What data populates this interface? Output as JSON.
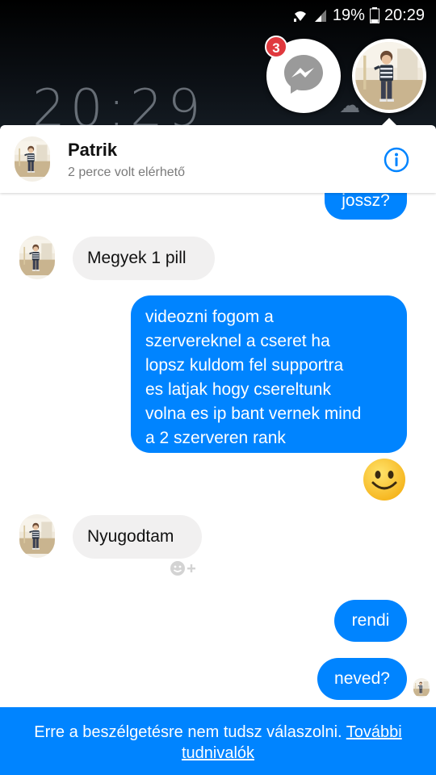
{
  "status_bar": {
    "battery": "19%",
    "time": "20:29",
    "icons": [
      "wifi-icon",
      "signal-icon",
      "battery-icon"
    ]
  },
  "wallpaper": {
    "clock": "20:29",
    "weather_icon": "snow-cloud-icon"
  },
  "chat_heads": {
    "messenger_badge_count": "3",
    "messenger_icon": "messenger-icon",
    "contact_avatar": "avatar"
  },
  "header": {
    "name": "Patrik",
    "status": "2 perce volt elérhető",
    "info_icon": "info-icon"
  },
  "messages": [
    {
      "direction": "out",
      "text": "jossz?"
    },
    {
      "direction": "in",
      "text": "Megyek 1 pill"
    },
    {
      "direction": "out",
      "lines": [
        "videozni fogom a",
        "szervereknel a cseret ha",
        "lopsz kuldom fel supportra",
        "es latjak hogy csereltunk",
        "volna es ip bant vernek mind",
        "a 2 szerveren rank"
      ]
    },
    {
      "direction": "out",
      "emoji": "smiley-emoji"
    },
    {
      "direction": "in",
      "text": "Nyugodtam",
      "reaction_icon": "add-reaction-icon"
    },
    {
      "direction": "out",
      "text": "rendi"
    },
    {
      "direction": "out",
      "text": "neved?"
    }
  ],
  "footer": {
    "text": "Erre a beszélgetésre nem tudsz válaszolni.",
    "link_part1": "További",
    "link_part2": "tudnivalók"
  },
  "colors": {
    "accent": "#0084ff",
    "incoming_bubble": "#f1f0f0",
    "badge": "#e0393e",
    "emoji": "#ffcc33"
  }
}
